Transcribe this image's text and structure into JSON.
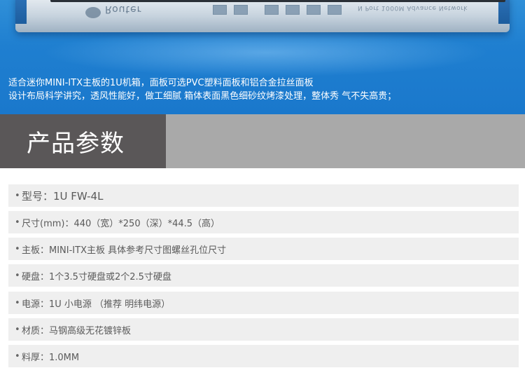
{
  "banner": {
    "chassis_brand": "Router",
    "chassis_model": "N Port 1000M Advance Network",
    "line1": "适合迷你MINI-ITX主板的1U机箱，面板可选PVC塑料面板和铝合金拉丝面板",
    "line2": "设计布局科学讲究，透风性能好，做工细腻 箱体表面黑色细砂纹烤漆处理，整体秀 气不失高贵；"
  },
  "section": {
    "title": "产品参数"
  },
  "specs": {
    "bullet": "•",
    "items": [
      {
        "text": "型号：1U FW-4L"
      },
      {
        "text": "尺寸(mm)：440（宽）*250（深）*44.5（高）"
      },
      {
        "text": "主板：MINI-ITX主板 具体参考尺寸图螺丝孔位尺寸"
      },
      {
        "text": "硬盘：1个3.5寸硬盘或2个2.5寸硬盘"
      },
      {
        "text": "电源：1U 小电源 （推荐 明纬电源）"
      },
      {
        "text": "材质：马钢高级无花镀锌板"
      },
      {
        "text": "料厚：1.0MM"
      }
    ]
  }
}
